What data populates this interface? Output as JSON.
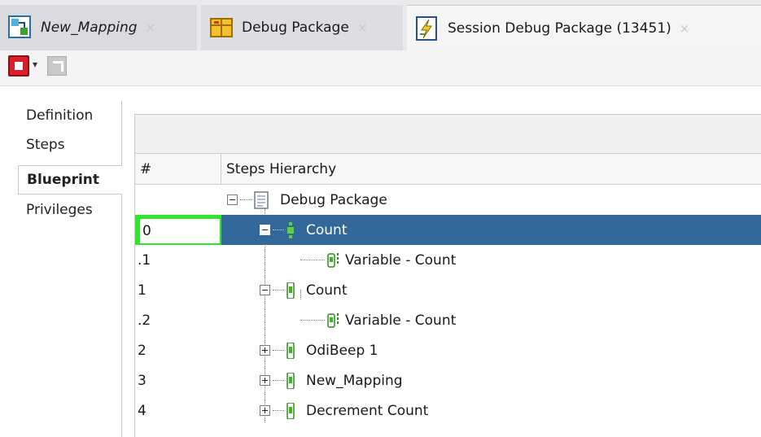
{
  "tabs": [
    {
      "label": "New_Mapping",
      "icon": "mapping-icon",
      "close": "×"
    },
    {
      "label": "Debug Package",
      "icon": "package-icon",
      "close": "×"
    },
    {
      "label": "Session Debug Package (13451)",
      "icon": "session-icon",
      "close": "×"
    }
  ],
  "toolbar": {
    "stop_icon": "stop-icon",
    "dropdown_icon": "dropdown-arrow-icon",
    "dropdown_glyph": "▾",
    "disabled_icon": "external-link-icon"
  },
  "side_tabs": [
    {
      "label": "Definition",
      "active": false
    },
    {
      "label": "Steps",
      "active": false
    },
    {
      "label": "Blueprint",
      "active": true
    },
    {
      "label": "Privileges",
      "active": false
    }
  ],
  "table": {
    "columns": [
      "#",
      "Steps Hierarchy"
    ],
    "rows": [
      {
        "num": "",
        "label": "Debug Package",
        "icon": "package-icon",
        "expander": "minus"
      },
      {
        "num": "0",
        "label": "Count",
        "icon": "step-icon",
        "expander": "minus",
        "selected": true,
        "editing": true
      },
      {
        "num": ".1",
        "label": "Variable - Count",
        "icon": "variable-icon",
        "expander": ""
      },
      {
        "num": "1",
        "label": "Count",
        "icon": "step-icon",
        "expander": "minus"
      },
      {
        "num": ".2",
        "label": "Variable - Count",
        "icon": "variable-icon",
        "expander": ""
      },
      {
        "num": "2",
        "label": "OdiBeep 1",
        "icon": "step-icon",
        "expander": "plus"
      },
      {
        "num": "3",
        "label": "New_Mapping",
        "icon": "step-icon",
        "expander": "plus"
      },
      {
        "num": "4",
        "label": "Decrement Count",
        "icon": "step-icon",
        "expander": "plus"
      }
    ]
  },
  "colors": {
    "selected_row": "#33699a",
    "edit_cell_border": "#2ee62e",
    "stop_button": "#d8202a",
    "step_icon": "#3cb81e"
  }
}
